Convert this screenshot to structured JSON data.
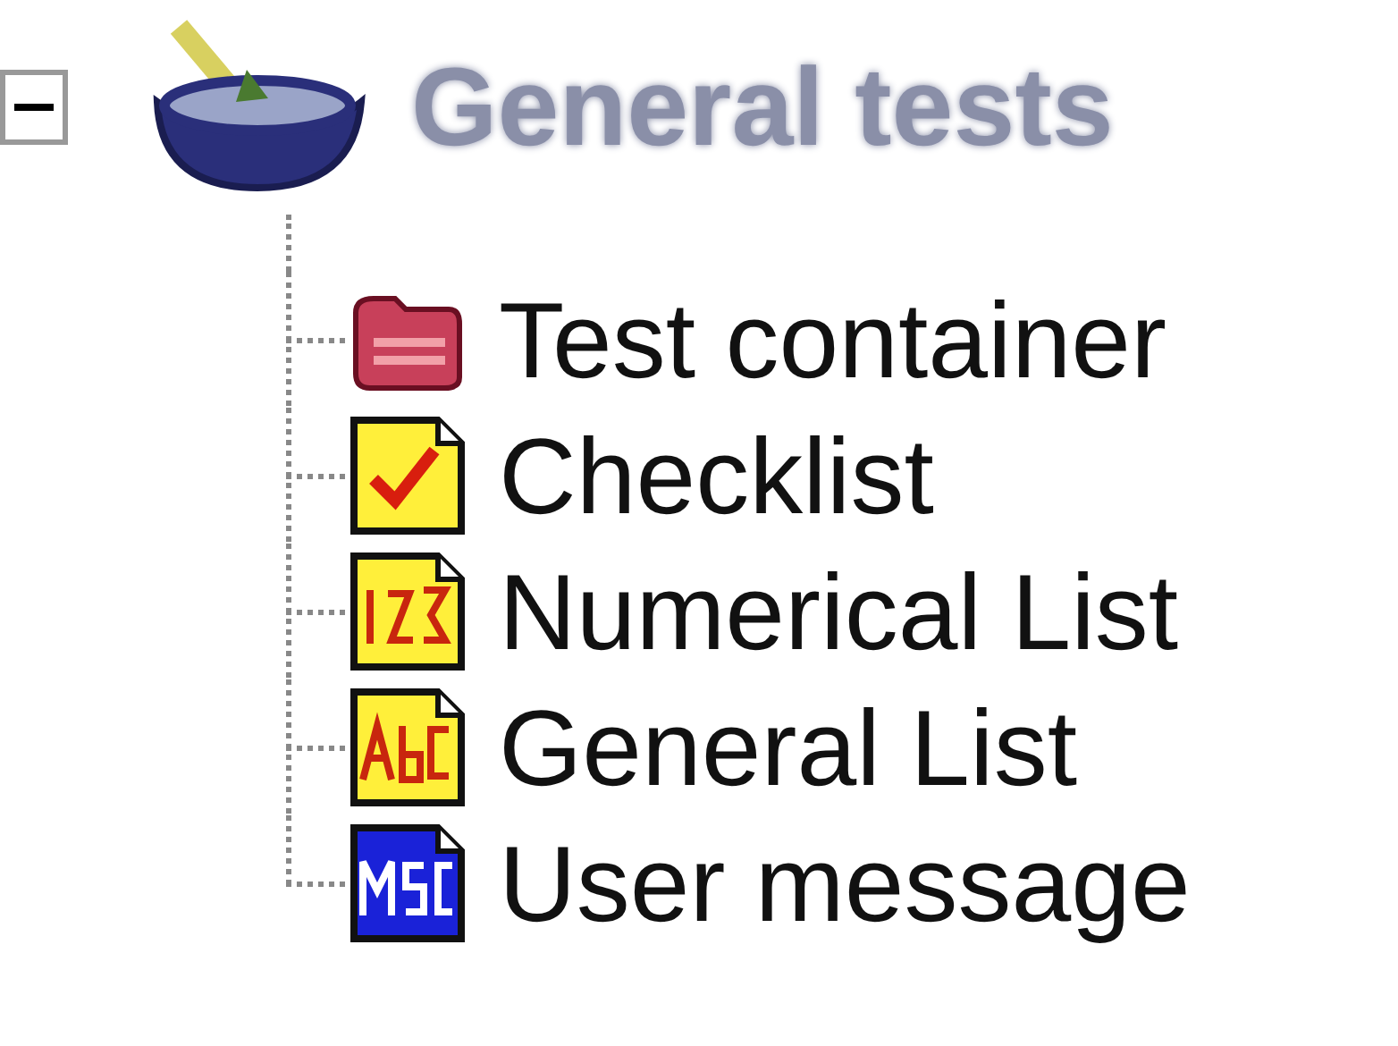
{
  "tree": {
    "label": "General tests",
    "expanded": true,
    "children": [
      {
        "label": "Test container",
        "kind": "container"
      },
      {
        "label": "Checklist",
        "kind": "checklist"
      },
      {
        "label": "Numerical List",
        "kind": "numerical"
      },
      {
        "label": "General List",
        "kind": "general"
      },
      {
        "label": "User message",
        "kind": "message"
      }
    ]
  }
}
